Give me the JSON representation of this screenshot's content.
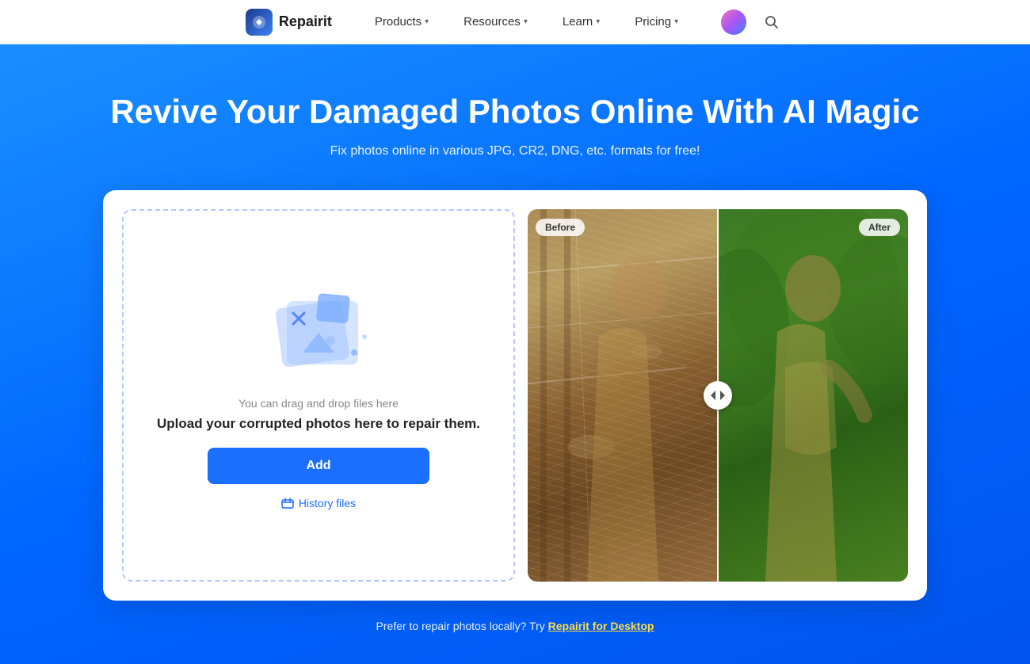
{
  "navbar": {
    "logo_text": "Repairit",
    "items": [
      {
        "label": "Products",
        "has_dropdown": true
      },
      {
        "label": "Resources",
        "has_dropdown": true
      },
      {
        "label": "Learn",
        "has_dropdown": true
      },
      {
        "label": "Pricing",
        "has_dropdown": true
      }
    ]
  },
  "hero": {
    "title": "Revive Your Damaged Photos Online With AI Magic",
    "subtitle": "Fix photos online in various JPG, CR2, DNG, etc. formats for free!",
    "upload_area": {
      "drag_hint": "You can drag and drop files here",
      "upload_label": "Upload your corrupted photos here to repair them.",
      "add_button": "Add",
      "history_label": "History files"
    },
    "before_label": "Before",
    "after_label": "After",
    "footer_text": "Prefer to repair photos locally? Try ",
    "footer_link": "Repairit for Desktop"
  }
}
